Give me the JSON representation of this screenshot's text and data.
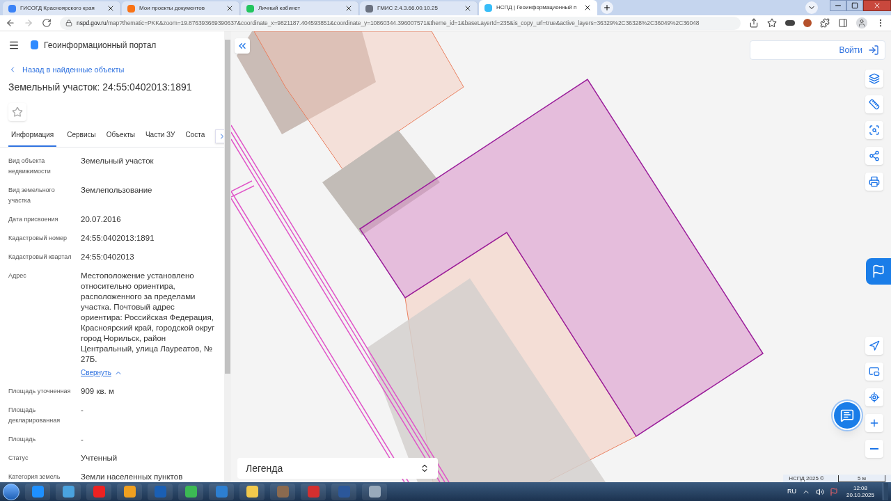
{
  "browser": {
    "tabs": [
      {
        "title": "ГИСОГД Красноярского края",
        "selected": false
      },
      {
        "title": "Мои проекты документов",
        "selected": false
      },
      {
        "title": "Личный кабинет",
        "selected": false
      },
      {
        "title": "ГМИС 2.4.3.66.00.10.25",
        "selected": false
      },
      {
        "title": "НСПД | Геоинформационный п",
        "selected": true
      }
    ],
    "url_host": "nspd.gov.ru",
    "url_path": "/map?thematic=PKK&zoom=19.876393669390637&coordinate_x=9821187.404593851&coordinate_y=10860344.396007571&theme_id=1&baseLayerId=235&is_copy_url=true&active_layers=36329%2C36328%2C36049%2C36048"
  },
  "portal": {
    "title": "Геоинформационный портал",
    "back_link": "Назад в найденные объекты",
    "object_title": "Земельный участок: 24:55:0402013:1891",
    "tabs": [
      {
        "label": "Информация",
        "selected": true
      },
      {
        "label": "Сервисы",
        "selected": false
      },
      {
        "label": "Объекты",
        "selected": false
      },
      {
        "label": "Части ЗУ",
        "selected": false
      },
      {
        "label": "Соста",
        "selected": false
      }
    ],
    "fields": [
      {
        "label": "Вид объекта недвижимости",
        "value": "Земельный участок"
      },
      {
        "label": "Вид земельного участка",
        "value": "Землепользование"
      },
      {
        "label": "Дата присвоения",
        "value": "20.07.2016"
      },
      {
        "label": "Кадастровый номер",
        "value": "24:55:0402013:1891"
      },
      {
        "label": "Кадастровый квартал",
        "value": "24:55:0402013"
      },
      {
        "label": "Адрес",
        "value": "Местоположение установлено относительно ориентира, расположенного за пределами участка. Почтовый адрес ориентира: Российская Федерация, Красноярский край, городской округ город Норильск, район Центральный, улица Лауреатов, № 27Б.",
        "collapse_link": "Свернуть"
      },
      {
        "label": "Площадь уточненная",
        "value": "909 кв. м"
      },
      {
        "label": "Площадь декларированная",
        "value": "-"
      },
      {
        "label": "Площадь",
        "value": "-"
      },
      {
        "label": "Статус",
        "value": "Учтенный"
      },
      {
        "label": "Категория земель",
        "value": "Земли населенных пунктов"
      }
    ]
  },
  "map": {
    "login_button": "Войти",
    "legend": "Легенда",
    "attribution": "НСПД 2025 ©",
    "scale": "5 м"
  },
  "taskbar": {
    "language": "RU",
    "time": "12:08",
    "date": "20.10.2025"
  }
}
